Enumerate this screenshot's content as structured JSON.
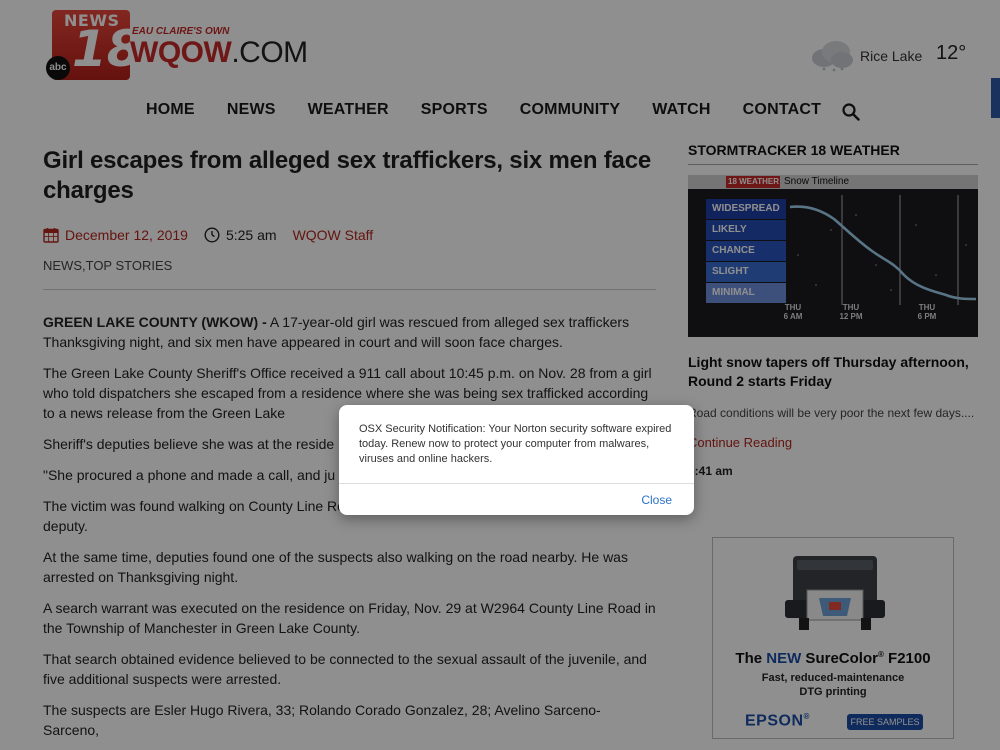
{
  "header": {
    "logo": {
      "news": "NEWS",
      "number": "18",
      "network": "abc",
      "tagline": "EAU CLAIRE'S OWN",
      "site_main": "WQOW",
      "site_suffix": ".COM"
    },
    "weather": {
      "city": "Rice Lake",
      "temperature": "12°",
      "icon": "cloud-snow-icon"
    },
    "nav": [
      "HOME",
      "NEWS",
      "WEATHER",
      "SPORTS",
      "COMMUNITY",
      "WATCH",
      "CONTACT"
    ],
    "search_icon": "search-icon"
  },
  "article": {
    "title": "Girl escapes from alleged sex traffickers, six men face charges",
    "date": "December 12, 2019",
    "time": "5:25 am",
    "author": "WQOW Staff",
    "categories": "NEWS,TOP STORIES",
    "lead_dateline": "GREEN LAKE COUNTY (WKOW) -",
    "lead_text": " A 17-year-old girl was rescued from alleged sex traffickers Thanksgiving night, and six men have appeared in court and will soon face charges.",
    "paragraphs": [
      "The Green Lake County Sheriff's Office received a 911 call about 10:45 p.m. on Nov. 28 from a girl who told dispatchers she escaped from a residence where she was being sex trafficked according to a news release from the Green Lake",
      "Sheriff's deputies believe she was at the reside",
      "\"She procured a phone and made a call, and ju Deputy Matthew Vande Kolk.",
      "The victim was found walking on County Line Road near Highway 73 and was rescued by a deputy.",
      "At the same time, deputies found one of the suspects also walking on the road nearby. He was arrested on Thanksgiving night.",
      "A search warrant was executed on the residence on Friday, Nov. 29 at W2964 County Line Road in the Township of Manchester in Green Lake County.",
      "That search obtained evidence believed to be connected to the sexual assault of the juvenile, and five additional suspects were arrested.",
      "The suspects are Esler Hugo Rivera, 33; Rolando Corado Gonzalez, 28; Avelino Sarceno-Sarceno,"
    ]
  },
  "sidebar": {
    "heading": "STORMTRACKER 18 WEATHER",
    "graphic": {
      "badge": "18 WEATHER",
      "title": "Snow Timeline",
      "levels": [
        "WIDESPREAD",
        "LIKELY",
        "CHANCE",
        "SLIGHT",
        "MINIMAL"
      ],
      "ticks": [
        {
          "day": "THU",
          "time": "6 AM"
        },
        {
          "day": "THU",
          "time": "12 PM"
        },
        {
          "day": "THU",
          "time": "6 PM"
        }
      ]
    },
    "story_title": "Light snow tapers off Thursday afternoon, Round 2 starts Friday",
    "excerpt": "Road conditions will be very poor the next few days....",
    "link": "Continue Reading",
    "time": "5:41 am"
  },
  "ad": {
    "title_the": "The ",
    "title_new": "NEW",
    "title_rest": " SureColor",
    "title_reg": "®",
    "title_model": " F2100",
    "subtitle_1": "Fast, reduced-maintenance",
    "subtitle_2": "DTG printing",
    "brand": "EPSON",
    "brand_reg": "®",
    "button": "FREE SAMPLES"
  },
  "dialog": {
    "message": "OSX Security Notification: Your Norton security software expired today. Renew now to protect your computer from malwares, viruses and online hackers.",
    "close_label": "Close"
  },
  "colors": {
    "accent_red": "#b3261e",
    "nav_text": "#1a1a1a",
    "link_blue": "#2b72c8",
    "overlay": "rgba(0,0,0,0.44)"
  }
}
